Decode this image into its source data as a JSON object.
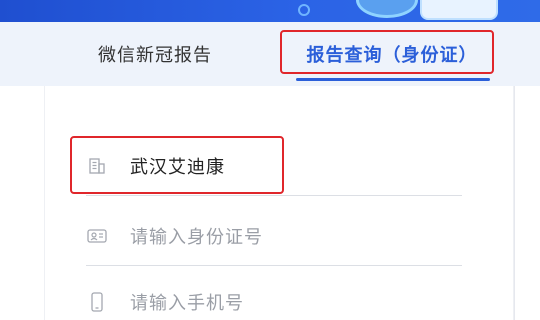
{
  "tabs": {
    "covid_report": "微信新冠报告",
    "report_query": "报告查询（身份证）",
    "active": "report_query"
  },
  "form": {
    "institution_value": "武汉艾迪康",
    "id_placeholder": "请输入身份证号",
    "phone_placeholder": "请输入手机号"
  },
  "icons": {
    "institution": "building-icon",
    "id": "id-card-icon",
    "phone": "mobile-phone-icon"
  },
  "colors": {
    "accent": "#2b5fd9",
    "highlight": "#e0262b",
    "banner": "#2b63e6",
    "tab_bg": "#eef3fb"
  }
}
